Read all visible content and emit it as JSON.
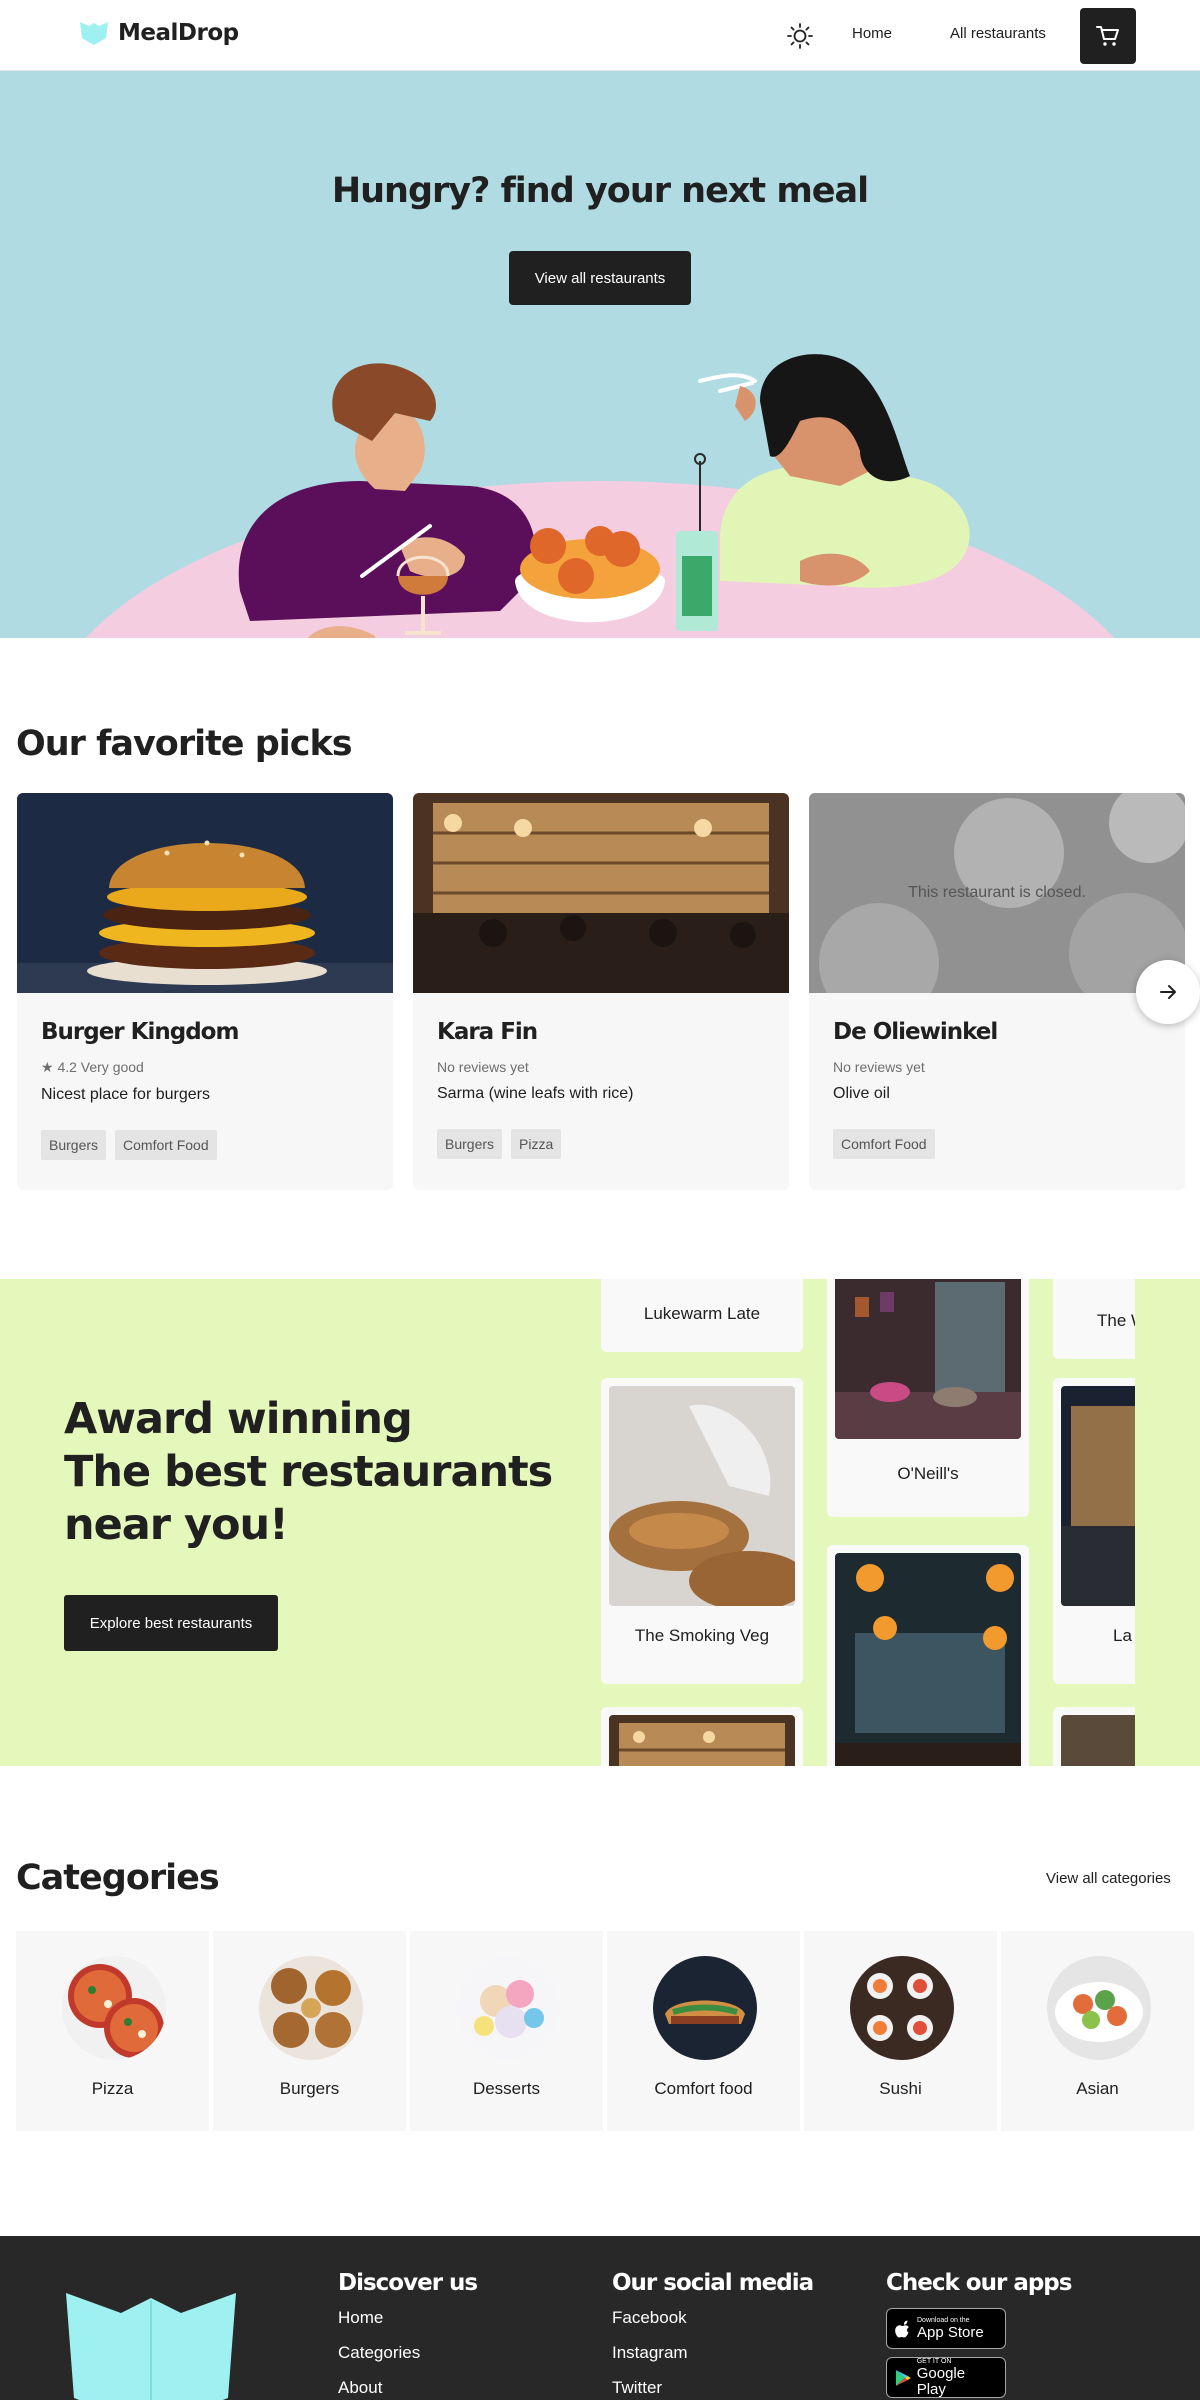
{
  "header": {
    "logo_text": "MealDrop",
    "nav": {
      "home": "Home",
      "all_restaurants": "All restaurants"
    },
    "icons": {
      "theme": "sun-icon",
      "cart": "cart-icon"
    }
  },
  "hero": {
    "title_bold": "Hungry?",
    "title_rest": " find your next meal",
    "button": "View all restaurants"
  },
  "picks": {
    "title": "Our favorite picks",
    "cards": [
      {
        "name": "Burger Kingdom",
        "rating": "★ 4.2 Very good",
        "description": "Nicest place for burgers",
        "tags": [
          "Burgers",
          "Comfort Food"
        ]
      },
      {
        "name": "Kara Fin",
        "rating": "No reviews yet",
        "description": "Sarma (wine leafs with rice)",
        "tags": [
          "Burgers",
          "Pizza"
        ]
      },
      {
        "name": "De Oliewinkel",
        "rating": "No reviews yet",
        "description": "Olive oil",
        "tags": [
          "Comfort Food"
        ],
        "overlay": "This restaurant is closed."
      }
    ]
  },
  "award": {
    "title_line1": "Award winning",
    "title_line2": "The best restaurants",
    "title_line3": "near you!",
    "button": "Explore best restaurants",
    "restaurants": [
      "Lukewarm Late",
      "The Smoking Veg",
      "O'Neill's",
      "The W",
      "La"
    ]
  },
  "categories": {
    "title": "Categories",
    "view_all": "View all categories",
    "items": [
      "Pizza",
      "Burgers",
      "Desserts",
      "Comfort food",
      "Sushi",
      "Asian"
    ]
  },
  "footer": {
    "discover": {
      "title": "Discover us",
      "links": [
        "Home",
        "Categories",
        "About"
      ]
    },
    "social": {
      "title": "Our social media",
      "links": [
        "Facebook",
        "Instagram",
        "Twitter"
      ]
    },
    "apps": {
      "title": "Check our apps",
      "app_store_small": "Download on the",
      "app_store_big": "App Store",
      "play_small": "GET IT ON",
      "play_big": "Google Play"
    }
  },
  "colors": {
    "primary": "#202020",
    "hero_bg": "#b0dbe2",
    "award_bg": "#e4f8bc",
    "brand": "#9ff1f1",
    "footer_bg": "#282828"
  }
}
